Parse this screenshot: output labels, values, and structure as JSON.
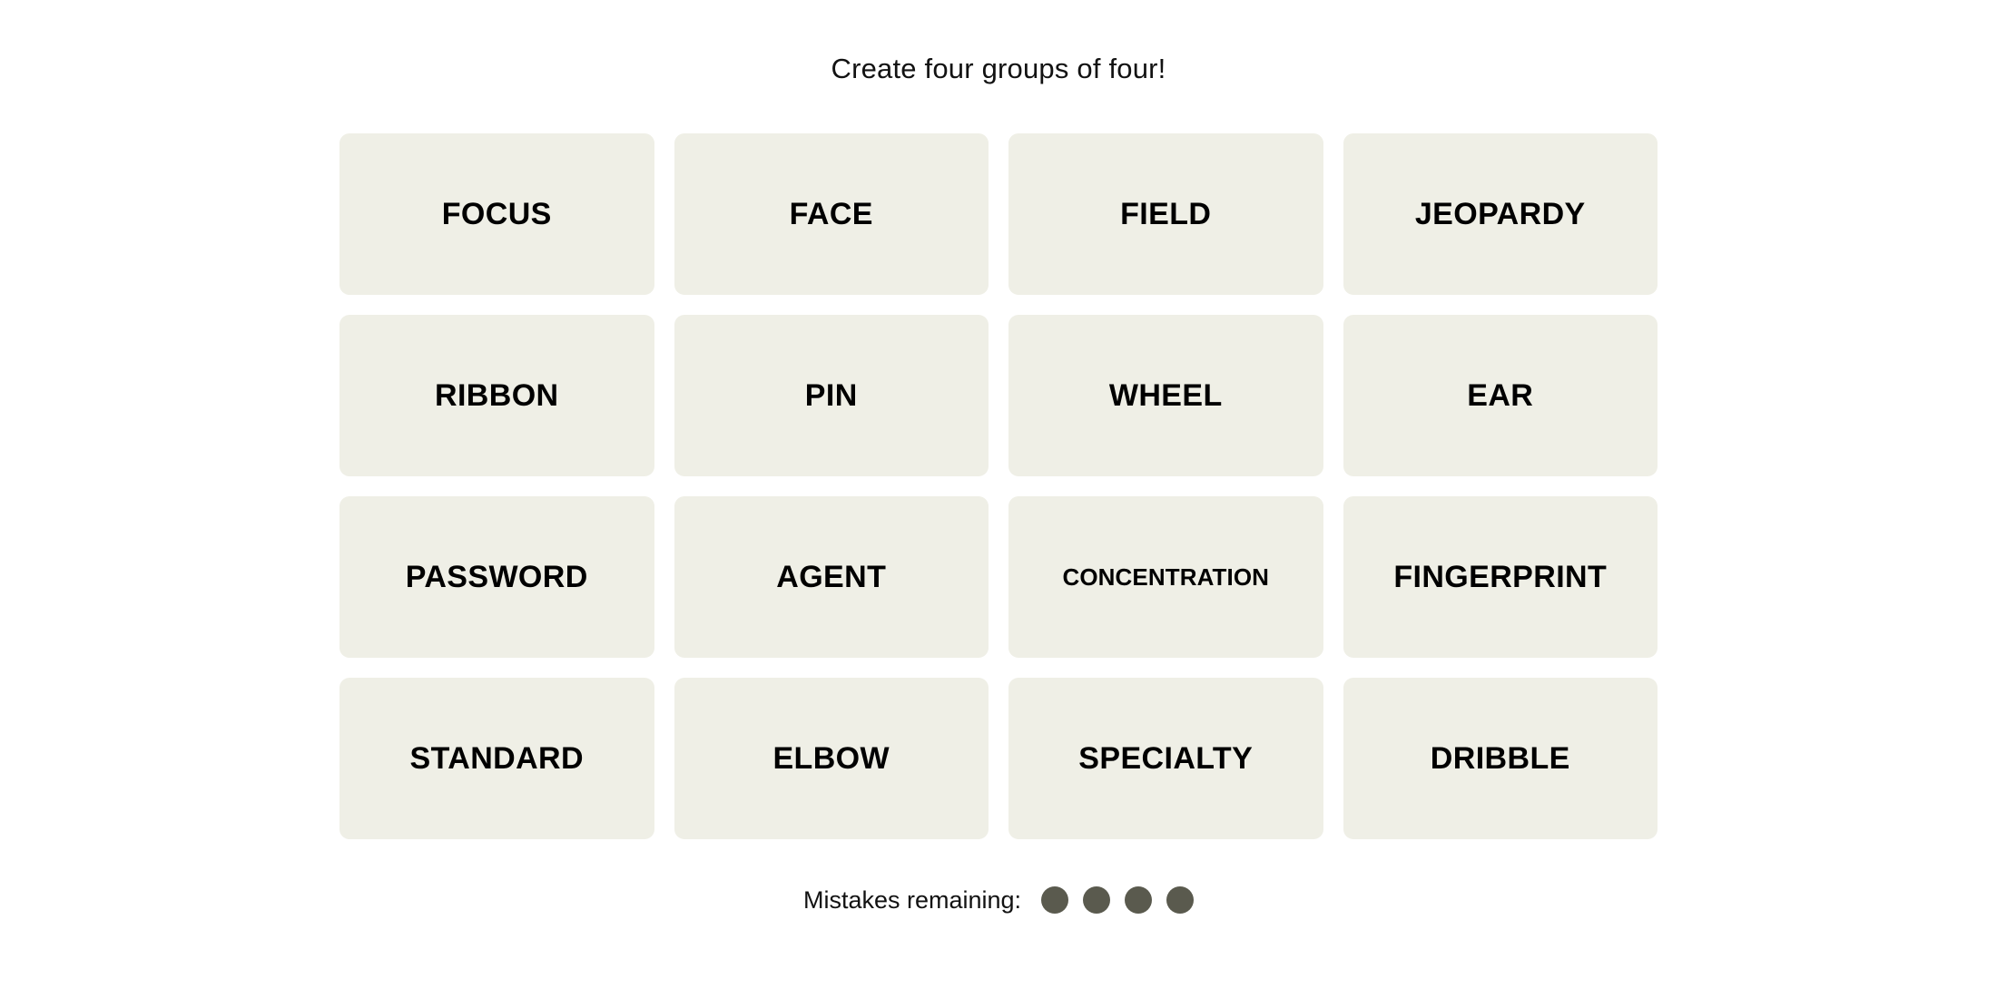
{
  "header": {
    "title": "Create four groups of four!"
  },
  "grid": {
    "rows": [
      [
        "FOCUS",
        "FACE",
        "FIELD",
        "JEOPARDY"
      ],
      [
        "RIBBON",
        "PIN",
        "WHEEL",
        "EAR"
      ],
      [
        "PASSWORD",
        "AGENT",
        "CONCENTRATION",
        "FINGERPRINT"
      ],
      [
        "STANDARD",
        "ELBOW",
        "SPECIALTY",
        "DRIBBLE"
      ]
    ],
    "tiles": [
      {
        "label": "FOCUS",
        "compact": false
      },
      {
        "label": "FACE",
        "compact": false
      },
      {
        "label": "FIELD",
        "compact": false
      },
      {
        "label": "JEOPARDY",
        "compact": false
      },
      {
        "label": "RIBBON",
        "compact": false
      },
      {
        "label": "PIN",
        "compact": false
      },
      {
        "label": "WHEEL",
        "compact": false
      },
      {
        "label": "EAR",
        "compact": false
      },
      {
        "label": "PASSWORD",
        "compact": false
      },
      {
        "label": "AGENT",
        "compact": false
      },
      {
        "label": "CONCENTRATION",
        "compact": true
      },
      {
        "label": "FINGERPRINT",
        "compact": false
      },
      {
        "label": "STANDARD",
        "compact": false
      },
      {
        "label": "ELBOW",
        "compact": false
      },
      {
        "label": "SPECIALTY",
        "compact": false
      },
      {
        "label": "DRIBBLE",
        "compact": false
      }
    ]
  },
  "footer": {
    "mistakes_label": "Mistakes remaining:",
    "mistakes_remaining": 4,
    "dot_icon_name": "mistake-dot-icon"
  },
  "colors": {
    "page_background": "#ffffff",
    "tile_background": "#EFEFE6",
    "tile_text": "#000000",
    "title_text": "#121212",
    "mistake_dot": "#5A5A4E"
  }
}
